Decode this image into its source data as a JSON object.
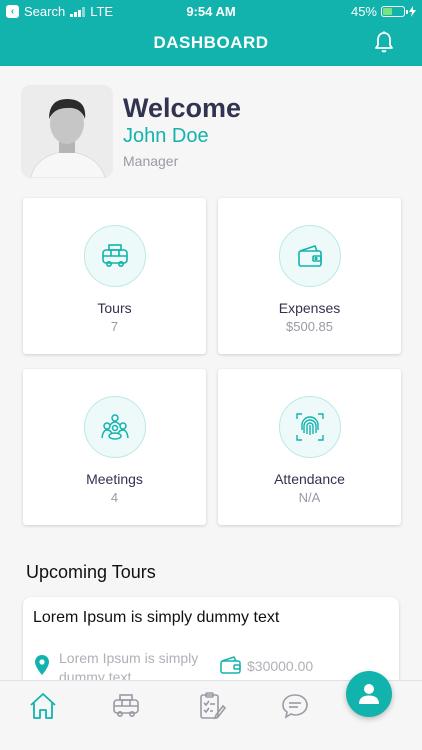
{
  "status": {
    "left": "Search",
    "network": "LTE",
    "time": "9:54 AM",
    "battery": "45%",
    "battery_level": 0.45
  },
  "header": {
    "title": "DASHBOARD"
  },
  "profile": {
    "greeting": "Welcome",
    "name": "John Doe",
    "role": "Manager"
  },
  "cards": [
    {
      "title": "Tours",
      "value": "7",
      "icon": "bus-icon"
    },
    {
      "title": "Expenses",
      "value": "$500.85",
      "icon": "wallet-icon"
    },
    {
      "title": "Meetings",
      "value": "4",
      "icon": "meeting-icon"
    },
    {
      "title": "Attendance",
      "value": "N/A",
      "icon": "fingerprint-icon"
    }
  ],
  "upcoming": {
    "title": "Upcoming Tours",
    "tour": {
      "title": "Lorem Ipsum is simply dummy text",
      "location": "Lorem Ipsum is simply dummy text",
      "amount": "$30000.00"
    }
  },
  "nav": [
    "home-icon",
    "bus-icon",
    "checklist-icon",
    "chat-icon"
  ],
  "colors": {
    "accent": "#12b3ad",
    "text_dark": "#323350",
    "muted": "#9a9aa4"
  }
}
